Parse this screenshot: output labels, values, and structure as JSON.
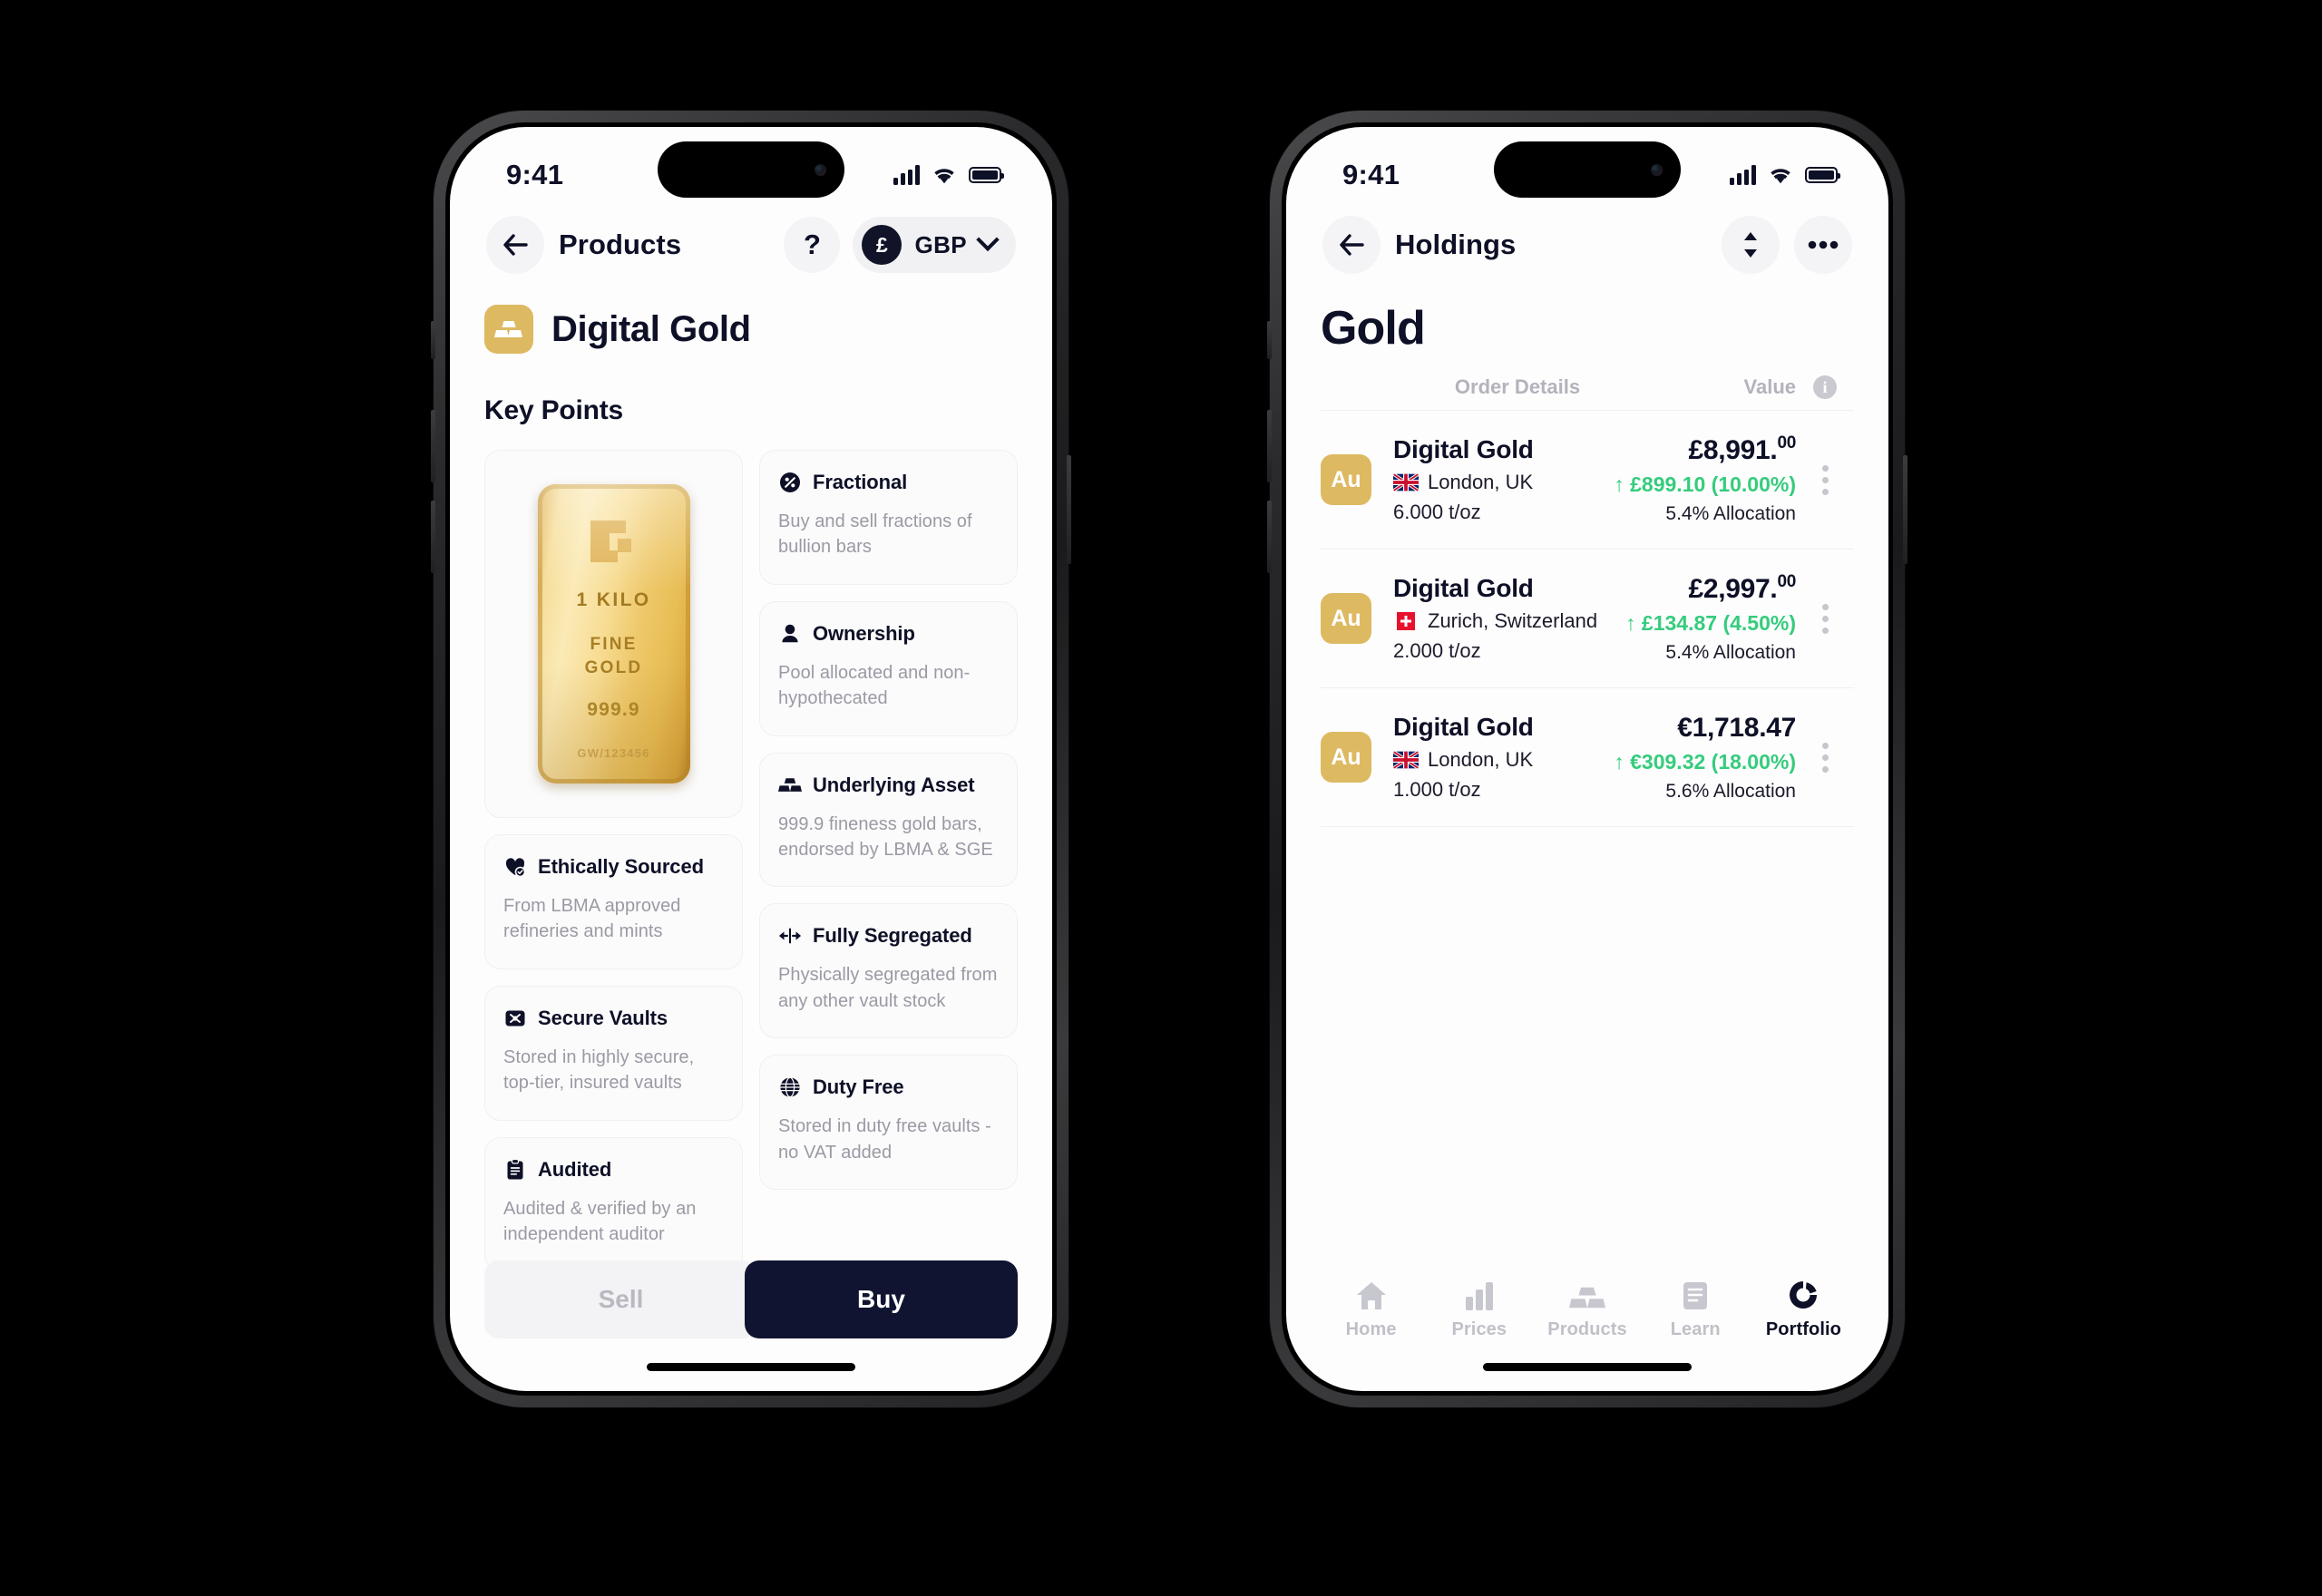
{
  "theme": {
    "gold": "#ddb962",
    "navy": "#101430",
    "green": "#35cc7d",
    "muted": "#9a9aa4"
  },
  "left_phone": {
    "status_bar": {
      "time": "9:41",
      "signal_icon": "cellular-bars-icon",
      "wifi_icon": "wifi-icon",
      "battery_icon": "battery-icon"
    },
    "nav": {
      "back_icon": "arrow-left-icon",
      "title": "Products",
      "help_label": "?",
      "currency_symbol": "£",
      "currency_code": "GBP",
      "chevron_icon": "chevron-down-icon"
    },
    "product": {
      "icon": "gold-bars-icon",
      "title": "Digital Gold"
    },
    "section_title": "Key Points",
    "gold_bar": {
      "weight": "1 KILO",
      "purity_line1": "FINE",
      "purity_line2": "GOLD",
      "fineness": "999.9",
      "serial": "GW/123456"
    },
    "key_points": [
      {
        "icon": "percent-circle-icon",
        "title": "Fractional",
        "desc": "Buy and sell fractions of bullion bars"
      },
      {
        "icon": "person-icon",
        "title": "Ownership",
        "desc": "Pool allocated and non-hypothecated"
      },
      {
        "icon": "gold-bars-icon",
        "title": "Underlying Asset",
        "desc": "999.9 fineness gold bars, endorsed by LBMA & SGE"
      },
      {
        "icon": "heart-check-icon",
        "title": "Ethically Sourced",
        "desc": "From LBMA approved refineries and mints"
      },
      {
        "icon": "segregate-arrows-icon",
        "title": "Fully Segregated",
        "desc": "Physically segregated from any other vault stock"
      },
      {
        "icon": "vault-icon",
        "title": "Secure Vaults",
        "desc": "Stored in highly secure, top-tier, insured vaults"
      },
      {
        "icon": "globe-icon",
        "title": "Duty Free",
        "desc": "Stored in duty free vaults - no VAT added"
      },
      {
        "icon": "clipboard-icon",
        "title": "Audited",
        "desc": "Audited & verified by an independent auditor"
      }
    ],
    "cta": {
      "sell_label": "Sell",
      "buy_label": "Buy"
    }
  },
  "right_phone": {
    "status_bar": {
      "time": "9:41",
      "signal_icon": "cellular-bars-icon",
      "wifi_icon": "wifi-icon",
      "battery_icon": "battery-icon"
    },
    "nav": {
      "back_icon": "arrow-left-icon",
      "title": "Holdings",
      "sort_icon": "sort-updown-icon",
      "more_icon": "more-horizontal-icon"
    },
    "page_title": "Gold",
    "columns": {
      "order_details": "Order Details",
      "value": "Value",
      "info_icon": "info-icon"
    },
    "holdings": [
      {
        "badge": "Au",
        "name": "Digital Gold",
        "flag": "uk-flag",
        "location": "London, UK",
        "quantity": "6.000 t/oz",
        "price_main": "£8,991.",
        "price_cents": "00",
        "delta": "↑ £899.10 (10.00%)",
        "allocation": "5.4% Allocation"
      },
      {
        "badge": "Au",
        "name": "Digital Gold",
        "flag": "swiss-flag",
        "location": "Zurich, Switzerland",
        "quantity": "2.000 t/oz",
        "price_main": "£2,997.",
        "price_cents": "00",
        "delta": "↑ £134.87 (4.50%)",
        "allocation": "5.4% Allocation"
      },
      {
        "badge": "Au",
        "name": "Digital Gold",
        "flag": "uk-flag",
        "location": "London, UK",
        "quantity": "1.000 t/oz",
        "price_main": "€1,718.47",
        "price_cents": "",
        "delta": "↑ €309.32 (18.00%)",
        "allocation": "5.6% Allocation"
      }
    ],
    "tabs": [
      {
        "icon": "home-icon",
        "label": "Home",
        "active": false
      },
      {
        "icon": "bar-chart-icon",
        "label": "Prices",
        "active": false
      },
      {
        "icon": "gold-bars-icon",
        "label": "Products",
        "active": false
      },
      {
        "icon": "document-icon",
        "label": "Learn",
        "active": false
      },
      {
        "icon": "donut-chart-icon",
        "label": "Portfolio",
        "active": true
      }
    ]
  }
}
